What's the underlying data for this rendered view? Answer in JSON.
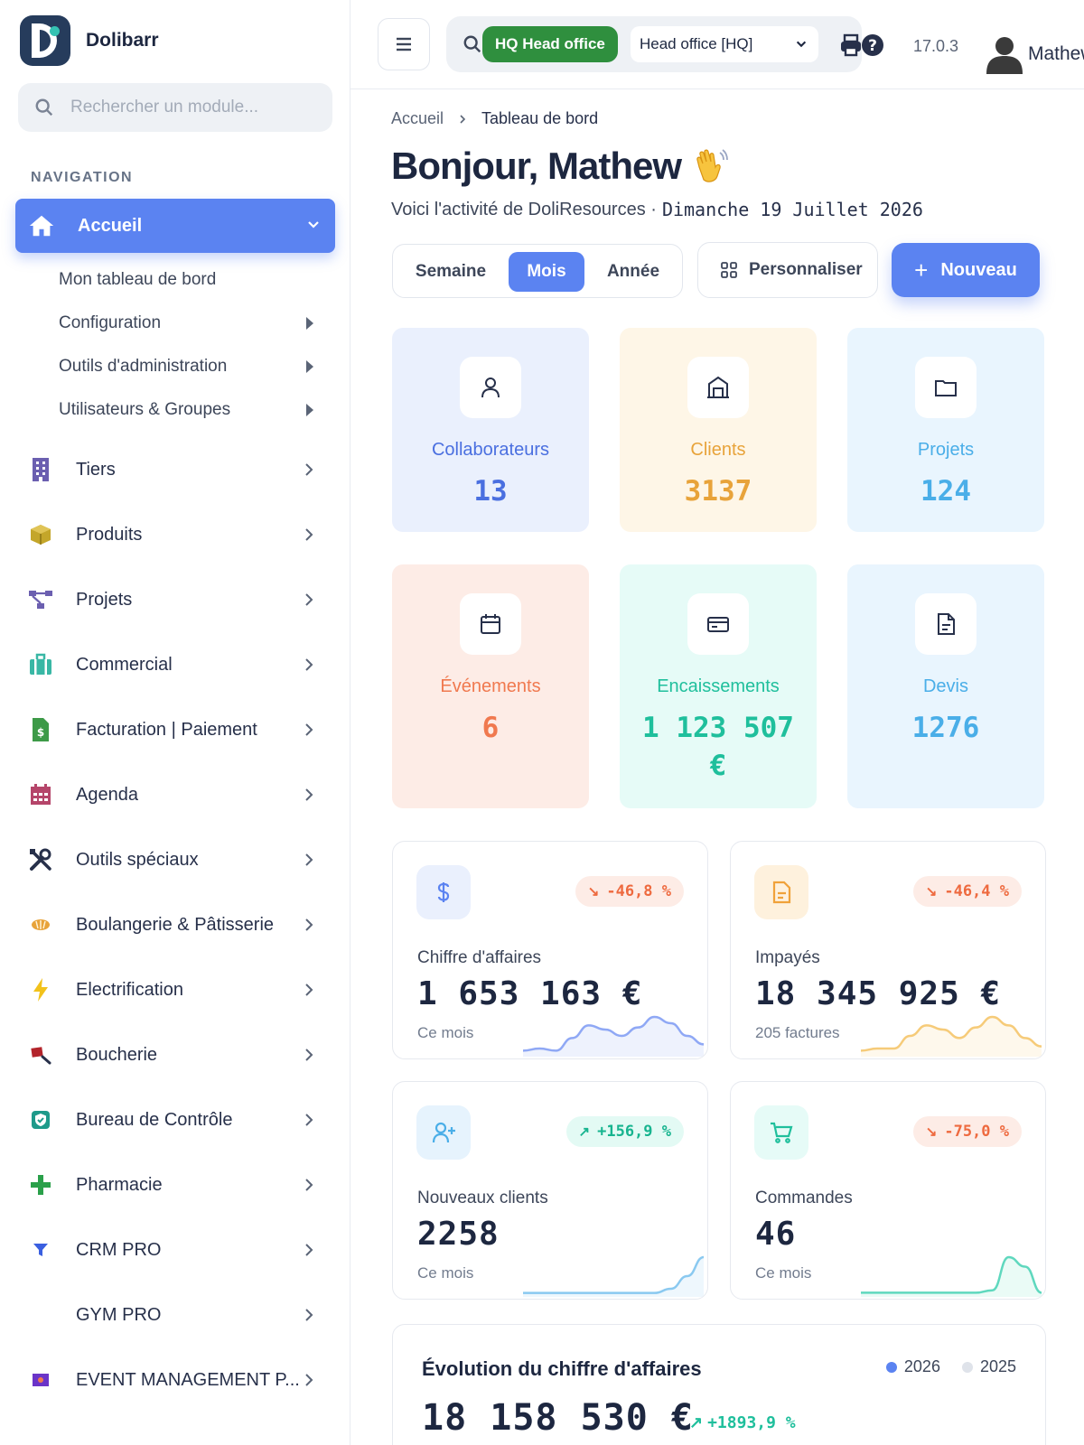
{
  "brand": {
    "name": "Dolibarr"
  },
  "module_search": {
    "placeholder": "Rechercher un module..."
  },
  "navigation": {
    "title": "NAVIGATION",
    "active": {
      "label": "Accueil",
      "icon": "home-icon"
    },
    "sub_items": [
      {
        "label": "Mon tableau de bord",
        "has_submenu": false
      },
      {
        "label": "Configuration",
        "has_submenu": true
      },
      {
        "label": "Outils d'administration",
        "has_submenu": true
      },
      {
        "label": "Utilisateurs & Groupes",
        "has_submenu": true
      }
    ],
    "items": [
      {
        "label": "Tiers",
        "icon": "building-icon",
        "color": "#6b5fb0"
      },
      {
        "label": "Produits",
        "icon": "box-icon",
        "color": "#b59a1f"
      },
      {
        "label": "Projets",
        "icon": "project-tree-icon",
        "color": "#6b5fb0"
      },
      {
        "label": "Commercial",
        "icon": "briefcase-icon",
        "color": "#39b7a5"
      },
      {
        "label": "Facturation | Paiement",
        "icon": "invoice-icon",
        "color": "#3d9a48"
      },
      {
        "label": "Agenda",
        "icon": "calendar-icon",
        "color": "#b5456a"
      },
      {
        "label": "Outils spéciaux",
        "icon": "tools-icon",
        "color": "#27304a"
      },
      {
        "label": "Boulangerie & Pâtisserie",
        "icon": "bread-icon",
        "color": "#e8a33a"
      },
      {
        "label": "Electrification",
        "icon": "bolt-icon",
        "color": "#f2c21b"
      },
      {
        "label": "Boucherie",
        "icon": "cleaver-icon",
        "color": "#b3242b"
      },
      {
        "label": "Bureau de Contrôle",
        "icon": "shield-check-icon",
        "color": "#1e9a8a"
      },
      {
        "label": "Pharmacie",
        "icon": "plus-cross-icon",
        "color": "#2aa04a"
      },
      {
        "label": "CRM PRO",
        "icon": "funnel-icon",
        "color": "#3a5fe0"
      },
      {
        "label": "GYM PRO",
        "icon": "",
        "color": "#27304a"
      },
      {
        "label": "EVENT MANAGEMENT P...",
        "icon": "event-icon",
        "color": "#6b34c8"
      }
    ]
  },
  "topbar": {
    "entity_badge": "HQ Head office",
    "entity_select": "Head office [HQ]",
    "version": "17.0.3",
    "username": "Mathew"
  },
  "breadcrumb": {
    "home": "Accueil",
    "current": "Tableau de bord"
  },
  "greeting": {
    "title": "Bonjour, Mathew",
    "subtitle": "Voici l'activité de DoliResources ·",
    "date": "Dimanche 19 Juillet 2026"
  },
  "period": {
    "options": [
      "Semaine",
      "Mois",
      "Année"
    ],
    "selected": "Mois"
  },
  "actions": {
    "customize": "Personnaliser",
    "new": "Nouveau"
  },
  "kpis": [
    {
      "label": "Collaborateurs",
      "value": "13",
      "icon": "user-icon",
      "bg": "#eaf0fd",
      "color": "#4a6fe0"
    },
    {
      "label": "Clients",
      "value": "3137",
      "icon": "storefront-icon",
      "bg": "#fef6e7",
      "color": "#e8a33a"
    },
    {
      "label": "Projets",
      "value": "124",
      "icon": "folder-icon",
      "bg": "#e9f5fe",
      "color": "#4aaee8"
    },
    {
      "label": "Événements",
      "value": "6",
      "icon": "calendar-icon",
      "bg": "#fdece6",
      "color": "#f0794f"
    },
    {
      "label": "Encaissements",
      "value": "1 123 507 €",
      "icon": "credit-card-icon",
      "bg": "#e6fbf7",
      "color": "#1fbf9c"
    },
    {
      "label": "Devis",
      "value": "1276",
      "icon": "document-icon",
      "bg": "#e9f5fe",
      "color": "#4aaee8"
    }
  ],
  "stats": [
    {
      "label": "Chiffre d'affaires",
      "value": "1 653 163 €",
      "sub": "Ce mois",
      "change": "-46,8 %",
      "trend": "down",
      "icon": "dollar-icon",
      "icon_bg": "#eaf0fd",
      "icon_color": "#5b83f1",
      "spark_color": "#8fa8f5",
      "spark_fill": "#eef2fd",
      "spark": [
        2,
        3,
        2,
        8,
        14,
        12,
        9,
        13,
        18,
        15,
        9,
        5
      ]
    },
    {
      "label": "Impayés",
      "value": "18 345 925 €",
      "sub": "205 factures",
      "change": "-46,4 %",
      "trend": "down",
      "icon": "invoice-icon",
      "icon_bg": "#fef1dd",
      "icon_color": "#f0a23a",
      "spark_color": "#f6cb79",
      "spark_fill": "#fef8ec",
      "spark": [
        2,
        3,
        3,
        9,
        14,
        12,
        8,
        13,
        18,
        14,
        8,
        4
      ]
    },
    {
      "label": "Nouveaux clients",
      "value": "2258",
      "sub": "Ce mois",
      "change": "+156,9 %",
      "trend": "up",
      "icon": "user-plus-icon",
      "icon_bg": "#e6f3fd",
      "icon_color": "#4aaee8",
      "spark_color": "#8ac9f0",
      "spark_fill": "#eef7fd",
      "spark": [
        1,
        1,
        1,
        1,
        1,
        1,
        1,
        1,
        1,
        3,
        9,
        18
      ]
    },
    {
      "label": "Commandes",
      "value": "46",
      "sub": "Ce mois",
      "change": "-75,0 %",
      "trend": "down",
      "icon": "cart-icon",
      "icon_bg": "#e6fbf7",
      "icon_color": "#1fbf9c",
      "spark_color": "#5fd8be",
      "spark_fill": "#eafbf6",
      "spark": [
        1,
        1,
        1,
        1,
        1,
        1,
        1,
        1,
        2,
        16,
        12,
        1
      ]
    }
  ],
  "evolution": {
    "title": "Évolution du chiffre d'affaires",
    "legend": [
      {
        "label": "2026",
        "color": "#5b83f1"
      },
      {
        "label": "2025",
        "color": "#dfe3ea"
      }
    ],
    "value": "18 158 530 €",
    "growth": "+1893,9 %"
  }
}
